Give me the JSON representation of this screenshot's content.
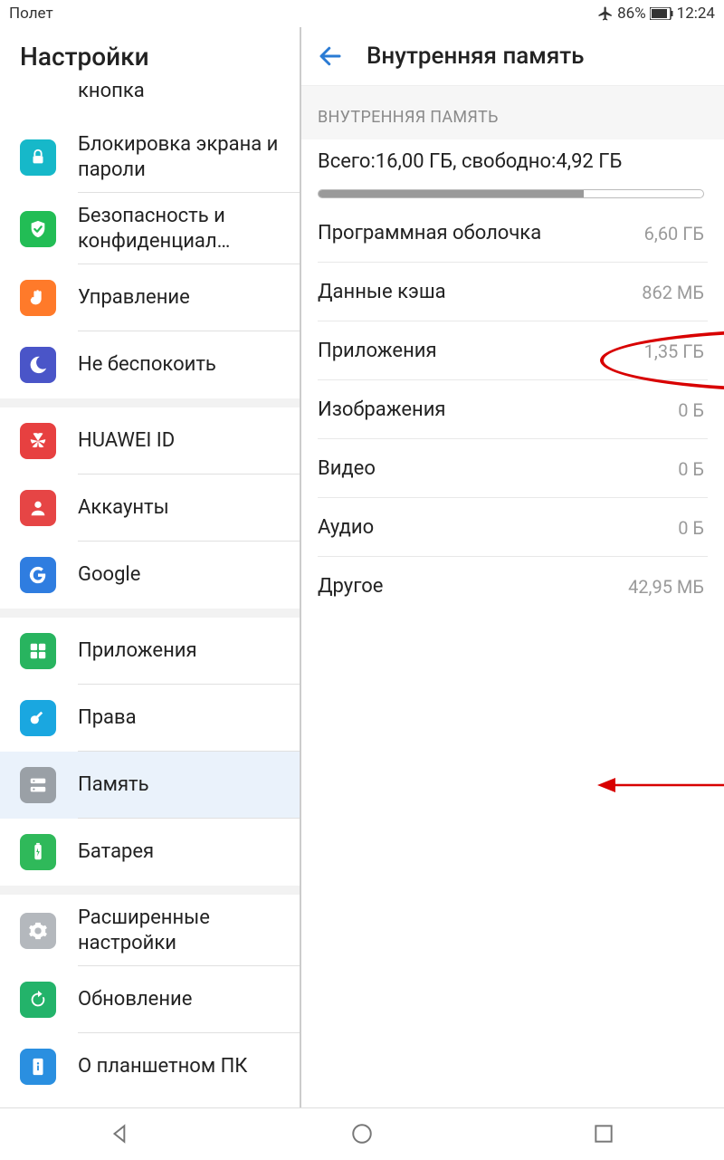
{
  "status": {
    "left_text": "Полет",
    "battery_pct": "86%",
    "time": "12:24"
  },
  "left": {
    "title": "Настройки",
    "items": [
      {
        "label": "кнопка",
        "icon": "nav-icon",
        "color": "#ff8a2e",
        "cutTop": true
      },
      {
        "label": "Блокировка экрана и пароли",
        "icon": "lock-icon",
        "color": "#16b8c9"
      },
      {
        "label": "Безопасность и конфиденциал…",
        "icon": "shield-icon",
        "color": "#22bd55"
      },
      {
        "label": "Управление",
        "icon": "hand-icon",
        "color": "#ff7a2a"
      },
      {
        "label": "Не беспокоить",
        "icon": "moon-icon",
        "color": "#4a55c8",
        "lastInGroup": true
      },
      {
        "label": "HUAWEI ID",
        "icon": "huawei-icon",
        "color": "#e74040"
      },
      {
        "label": "Аккаунты",
        "icon": "user-icon",
        "color": "#e64545"
      },
      {
        "label": "Google",
        "icon": "google-icon",
        "color": "#2f7de0",
        "lastInGroup": true
      },
      {
        "label": "Приложения",
        "icon": "apps-icon",
        "color": "#28b45f"
      },
      {
        "label": "Права",
        "icon": "key-icon",
        "color": "#1aa7e0"
      },
      {
        "label": "Память",
        "icon": "storage-icon",
        "color": "#9aa0a6",
        "selected": true
      },
      {
        "label": "Батарея",
        "icon": "battery-icon",
        "color": "#2fb95a",
        "lastInGroup": true
      },
      {
        "label": "Расширенные настройки",
        "icon": "gear-icon",
        "color": "#b4b8bd"
      },
      {
        "label": "Обновление",
        "icon": "update-icon",
        "color": "#23b36a"
      },
      {
        "label": "О планшетном ПК",
        "icon": "info-icon",
        "color": "#2a8fe0"
      }
    ]
  },
  "right": {
    "title": "Внутренняя память",
    "section_label": "ВНУТРЕННЯЯ ПАМЯТЬ",
    "total_label": "Всего: ",
    "total_value": "16,00 ГБ",
    "free_label": ", свободно: ",
    "free_value": "4,92 ГБ",
    "progress_pct": 69,
    "rows": [
      {
        "name": "Программная оболочка",
        "value": "6,60 ГБ"
      },
      {
        "name": "Данные кэша",
        "value": "862 МБ"
      },
      {
        "name": "Приложения",
        "value": "1,35 ГБ"
      },
      {
        "name": "Изображения",
        "value": "0 Б"
      },
      {
        "name": "Видео",
        "value": "0 Б"
      },
      {
        "name": "Аудио",
        "value": "0 Б"
      },
      {
        "name": "Другое",
        "value": "42,95 МБ"
      }
    ]
  }
}
